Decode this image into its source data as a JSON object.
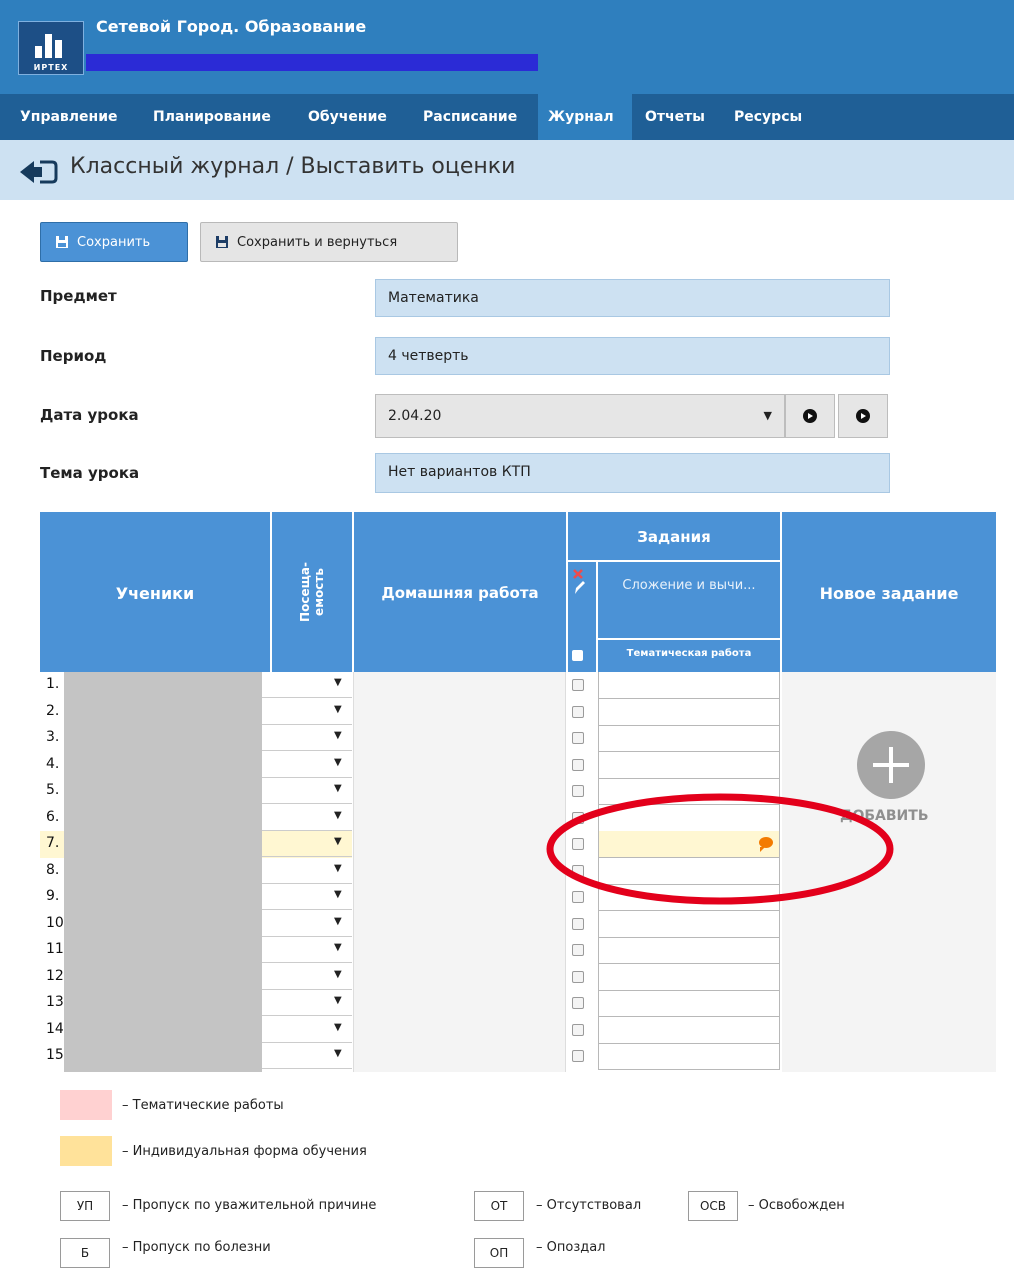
{
  "app": {
    "title": "Сетевой Город. Образование",
    "logo_text": "ИРТЕХ"
  },
  "menu": [
    "Управление",
    "Планирование",
    "Обучение",
    "Расписание",
    "Журнал",
    "Отчеты",
    "Ресурсы"
  ],
  "menu_active": "Журнал",
  "breadcrumb": "Классный журнал / Выставить оценки",
  "toolbar": {
    "save_label": "Сохранить",
    "save_return_label": "Сохранить и вернуться"
  },
  "form": {
    "subject_label": "Предмет",
    "subject_value": "Математика",
    "period_label": "Период",
    "period_value": "4 четверть",
    "date_label": "Дата урока",
    "date_value": "2.04.20",
    "topic_label": "Тема урока",
    "topic_value": "Нет вариантов КТП"
  },
  "table": {
    "col_students": "Ученики",
    "col_attendance": "Посеща-емость",
    "col_homework": "Домашняя работа",
    "col_tasks": "Задания",
    "task_name": "Сложение и вычи...",
    "task_type": "Тематическая работа",
    "col_new_task": "Новое задание",
    "add_label": "ДОБАВИТЬ",
    "rows": [
      "1.",
      "2.",
      "3.",
      "4.",
      "5.",
      "6.",
      "7.",
      "8.",
      "9.",
      "10",
      "11",
      "12",
      "13",
      "14",
      "15"
    ],
    "highlighted_row": 7
  },
  "legend": {
    "thematic": "– Тематические работы",
    "individual": "– Индивидуальная форма обучения",
    "codes": [
      {
        "code": "УП",
        "text": "– Пропуск по уважительной причине"
      },
      {
        "code": "ОТ",
        "text": "– Отсутствовал"
      },
      {
        "code": "ОСВ",
        "text": "– Освобожден"
      },
      {
        "code": "Б",
        "text": "– Пропуск по болезни"
      },
      {
        "code": "ОП",
        "text": "– Опоздал"
      }
    ]
  },
  "colors": {
    "header": "#2f7fbe",
    "menubar": "#1f5f96",
    "table_header": "#4b92d6",
    "thematic": "#ffd1d1",
    "individual": "#ffe29a",
    "highlight_row": "#fff7d2",
    "annotation": "#e3001b"
  }
}
